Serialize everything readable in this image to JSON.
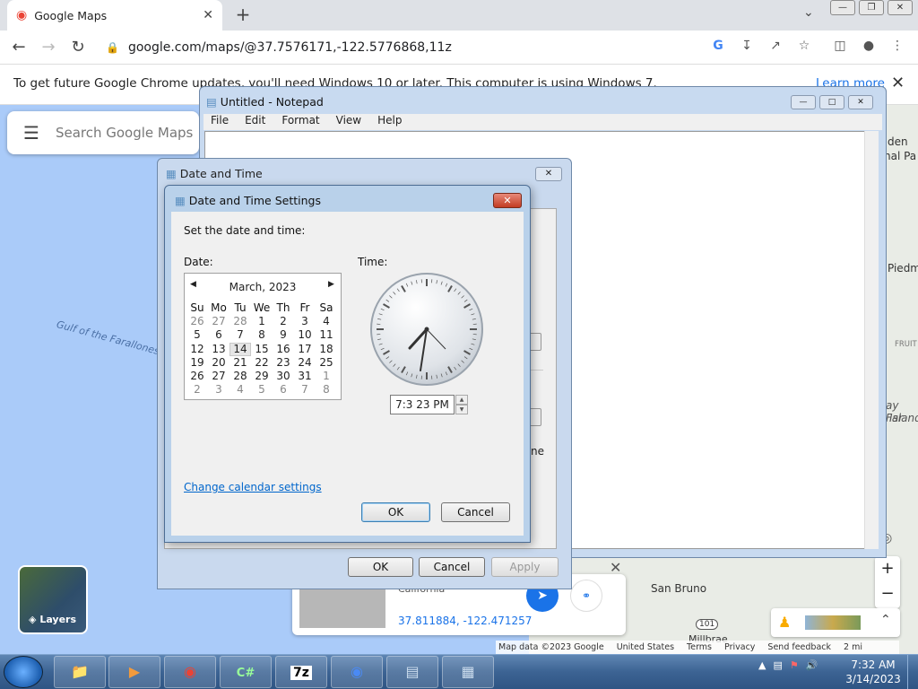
{
  "browser": {
    "tab_title": "Google Maps",
    "url": "google.com/maps/@37.7576171,-122.5776868,11z",
    "infobar_text": "To get future Google Chrome updates, you'll need Windows 10 or later. This computer is using Windows 7.",
    "learn_more": "Learn more"
  },
  "maps": {
    "search_placeholder": "Search Google Maps",
    "gulf_label": "Gulf of the Farallones",
    "layers_label": "Layers",
    "card_subtitle": "California",
    "card_coords": "37.811884, -122.471257",
    "labels": [
      "den",
      "nal Pa",
      "Piedm",
      "FRUIT",
      "ay Far",
      "Island",
      "San Bruno",
      "Millbrae",
      "101"
    ],
    "attribution": [
      "Map data ©2023 Google",
      "United States",
      "Terms",
      "Privacy",
      "Send feedback",
      "2 mi"
    ]
  },
  "notepad": {
    "title": "Untitled - Notepad",
    "menu": [
      "File",
      "Edit",
      "Format",
      "View",
      "Help"
    ]
  },
  "date_time": {
    "title": "Date and Time",
    "partial_text": "ne",
    "ok": "OK",
    "cancel": "Cancel",
    "apply": "Apply"
  },
  "settings": {
    "title": "Date and Time Settings",
    "instruction": "Set the date and time:",
    "date_label": "Date:",
    "time_label": "Time:",
    "month": "March, 2023",
    "weekdays": [
      "Su",
      "Mo",
      "Tu",
      "We",
      "Th",
      "Fr",
      "Sa"
    ],
    "weeks": [
      [
        "26",
        "27",
        "28",
        "1",
        "2",
        "3",
        "4"
      ],
      [
        "5",
        "6",
        "7",
        "8",
        "9",
        "10",
        "11"
      ],
      [
        "12",
        "13",
        "14",
        "15",
        "16",
        "17",
        "18"
      ],
      [
        "19",
        "20",
        "21",
        "22",
        "23",
        "24",
        "25"
      ],
      [
        "26",
        "27",
        "28",
        "29",
        "30",
        "31",
        "1"
      ],
      [
        "2",
        "3",
        "4",
        "5",
        "6",
        "7",
        "8"
      ]
    ],
    "selected_day": "14",
    "time_value": "7:3 23 PM",
    "change_calendar": "Change calendar settings",
    "ok": "OK",
    "cancel": "Cancel"
  },
  "taskbar": {
    "time": "7:32 AM",
    "date": "3/14/2023",
    "items": [
      "explorer",
      "media",
      "chrome",
      "csharp",
      "7z",
      "chrome-2",
      "notepad",
      "datetime"
    ],
    "item_7z": "7z",
    "item_cs": "C#"
  }
}
